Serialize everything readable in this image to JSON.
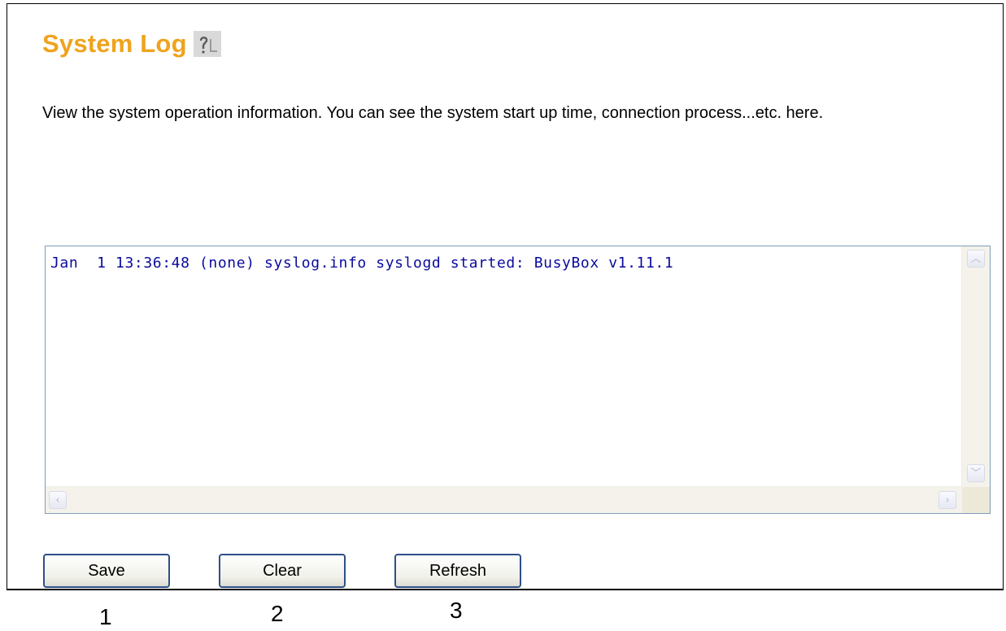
{
  "header": {
    "title": "System Log",
    "help_icon": "help-icon"
  },
  "description": "View the system operation information. You can see the system start up time, connection process...etc. here.",
  "log": {
    "content": "Jan  1 13:36:48 (none) syslog.info syslogd started: BusyBox v1.11.1",
    "text_color": "#0b0b9c"
  },
  "buttons": {
    "save": "Save",
    "clear": "Clear",
    "refresh": "Refresh"
  },
  "annotations": {
    "save": "1",
    "clear": "2",
    "refresh": "3"
  },
  "colors": {
    "title": "#efa31d",
    "button_border": "#2f4f88",
    "log_border": "#7f9db9"
  }
}
